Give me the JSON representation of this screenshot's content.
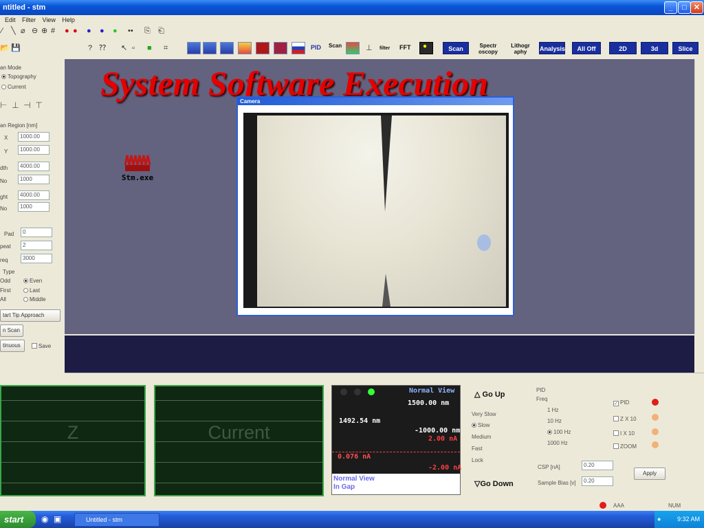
{
  "window": {
    "title": "Untitled - stm",
    "title_visible": "ntitled - stm"
  },
  "menu": [
    "Edit",
    "Filter",
    "View",
    "Help"
  ],
  "toolbar": {
    "text_buttons": {
      "pid": "PID",
      "scan_ico": "Scan",
      "filter": "filter",
      "fft": "FFT",
      "scan": "Scan",
      "spectroscopy": "Spectr oscopy",
      "lithography": "Lithogr aphy",
      "analysis": "Analysis",
      "all_off": "All Off",
      "two_d": "2D",
      "three_d": "3d",
      "slice": "Slice"
    }
  },
  "left_panel": {
    "scan_mode_label": "an Mode",
    "topography": "Topography",
    "current": "Current",
    "scan_region_label": "an Region [nm]",
    "x_label": "X",
    "x_value": "1000.00",
    "y_label": "Y",
    "y_value": "1000.00",
    "width_label": "dth",
    "width_value": "4000.00",
    "xno_label": "No",
    "xno_value": "1000",
    "height_label": "ght",
    "height_value": "4000.00",
    "yno_label": "No",
    "yno_value": "1000",
    "pad_label": "Pad",
    "pad_value": "0",
    "repeat_label": "peat",
    "repeat_value": "2",
    "freq_label": "req",
    "freq_value": "3000",
    "type_label": "Type",
    "odd": "Odd",
    "even": "Even",
    "first": "First",
    "last": "Last",
    "all": "All",
    "middle": "Middle",
    "tip_approach": "tart Tip Approach",
    "scan_btn": "n Scan",
    "continuous_btn": "tinuous",
    "save": "Save"
  },
  "slide_title": "System Software Execution",
  "camera_title": "Camera",
  "desktop_icon": "Stm.exe",
  "monitors": {
    "z": "Z",
    "current": "Current"
  },
  "gauge": {
    "normal_view": "Normal View",
    "top": "1500.00 nm",
    "value_nm": "1492.54 nm",
    "bottom_nm": "-1000.00 nm",
    "top_na": "2.00 nA",
    "value_na": "0.076 nA",
    "bottom_na": "-2.00 nA",
    "footer_1": "Normal View",
    "footer_2": "In Gap"
  },
  "motion": {
    "go_up": "Go Up",
    "go_down": "Go Down",
    "speeds": [
      "Very Slow",
      "Slow",
      "Medium",
      "Fast",
      "Lock"
    ],
    "selected_speed": "Slow"
  },
  "pid": {
    "label": "PID",
    "freq_label": "Freq",
    "freqs": [
      "1 Hz",
      "10 Hz",
      "100 Hz",
      "1000 Hz"
    ],
    "selected_freq": "100 Hz",
    "checks": [
      "PID",
      "Z X 10",
      "I X 10",
      "ZOOM"
    ],
    "csp_label": "CSP [nA]",
    "csp_value": "0.20",
    "bias_label": "Sample Bias [v]",
    "bias_value": "0.20",
    "apply": "Apply"
  },
  "status": {
    "indicator": "AAA",
    "num": "NUM"
  },
  "taskbar": {
    "start": "start",
    "task": "Untitled - stm",
    "clock": "9:32 AM"
  },
  "colors": {
    "title_red": "#e60000",
    "workspace": "#636380",
    "monitor_border": "#3aa84a"
  }
}
